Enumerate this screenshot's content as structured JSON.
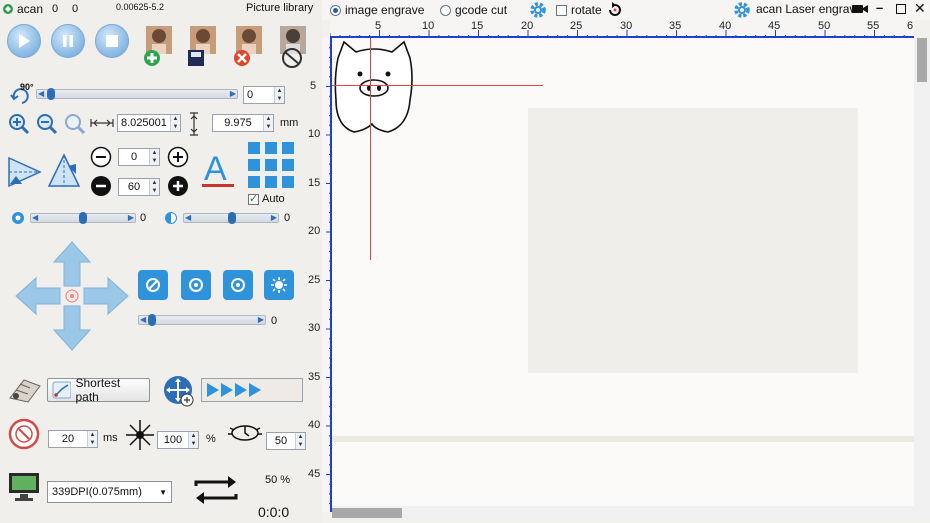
{
  "app": {
    "logo_text": "acan",
    "counter_a": "0",
    "counter_b": "0",
    "version": "0.00625-5.2",
    "picture_library": "Picture library",
    "window_title": "acan Laser engraving"
  },
  "toolbar": {
    "image_engrave": "image engrave",
    "gcode_cut": "gcode cut",
    "rotate": "rotate",
    "mode_selected": "image engrave",
    "rotate_checked": false
  },
  "controls": {
    "rotate_label": "90°",
    "rotate_value": "0",
    "width_value": "8.025001",
    "height_value": "9.975",
    "unit": "mm",
    "spacing_value": "0",
    "size_value": "60",
    "auto_label": "Auto",
    "auto_checked": true,
    "brightness_value": "0",
    "contrast_value": "0",
    "power_slider_value": "0",
    "shortest_path": "Shortest path",
    "burn_time": "20",
    "burn_unit": "ms",
    "laser_power": "100",
    "laser_unit": "%",
    "depth_value": "50",
    "dpi_option": "339DPI(0.075mm)",
    "progress": "50 %",
    "timer": "0:0:0"
  },
  "ruler": {
    "top_ticks": [
      "5",
      "10",
      "15",
      "20",
      "25",
      "30",
      "35",
      "40",
      "45",
      "50",
      "55",
      "6"
    ],
    "left_ticks": [
      "5",
      "10",
      "15",
      "20",
      "25",
      "30",
      "35",
      "40",
      "45"
    ]
  },
  "colors": {
    "accent_blue": "#2f93dc",
    "ruler_blue": "#1e3fd0",
    "crosshair_red": "#d44a4a"
  }
}
